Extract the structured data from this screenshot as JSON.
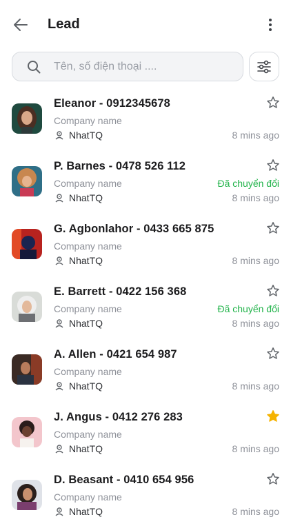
{
  "header": {
    "title": "Lead",
    "back_icon": "arrow-left-icon",
    "more_icon": "more-vertical-icon"
  },
  "search": {
    "placeholder": "Tên, số điện thoại ....",
    "value": "",
    "icon": "search-icon",
    "filter_icon": "sliders-icon"
  },
  "colors": {
    "status_green": "#21b34a",
    "star_active": "#f5b301",
    "muted_text": "#8e9199"
  },
  "leads": [
    {
      "name": "Eleanor - 0912345678",
      "company": "Company name",
      "owner": "NhatTQ",
      "time": "8 mins ago",
      "status": "",
      "starred": false,
      "avatar": "avatar-1"
    },
    {
      "name": "P. Barnes - 0478 526 112",
      "company": "Company name",
      "owner": "NhatTQ",
      "time": "8 mins ago",
      "status": "Đã chuyển đổi",
      "starred": false,
      "avatar": "avatar-2"
    },
    {
      "name": "G. Agbonlahor - 0433 665 875",
      "company": "Company name",
      "owner": "NhatTQ",
      "time": "8 mins ago",
      "status": "",
      "starred": false,
      "avatar": "avatar-3"
    },
    {
      "name": "E. Barrett - 0422 156 368",
      "company": "Company name",
      "owner": "NhatTQ",
      "time": "8 mins ago",
      "status": "Đã chuyển đổi",
      "starred": false,
      "avatar": "avatar-4"
    },
    {
      "name": "A. Allen - 0421 654 987",
      "company": "Company name",
      "owner": "NhatTQ",
      "time": "8 mins ago",
      "status": "",
      "starred": false,
      "avatar": "avatar-5"
    },
    {
      "name": "J. Angus - 0412 276 283",
      "company": "Company name",
      "owner": "NhatTQ",
      "time": "8 mins ago",
      "status": "",
      "starred": true,
      "avatar": "avatar-6"
    },
    {
      "name": "D. Beasant - 0410 654 956",
      "company": "Company name",
      "owner": "NhatTQ",
      "time": "8 mins ago",
      "status": "",
      "starred": false,
      "avatar": "avatar-7"
    }
  ]
}
